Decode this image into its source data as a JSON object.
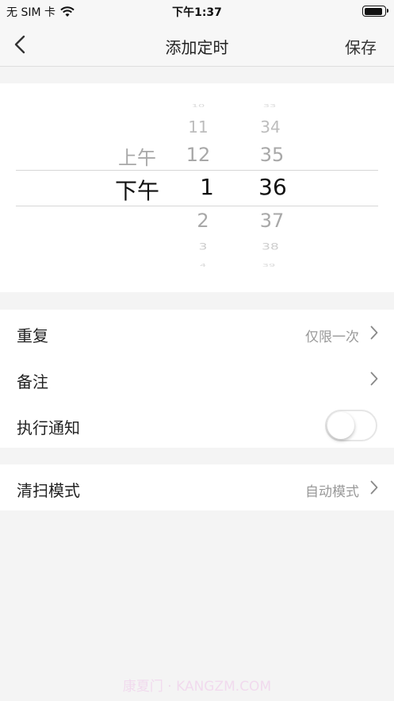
{
  "status_bar": {
    "carrier": "无 SIM 卡",
    "time": "下午1:37",
    "battery_level": 0.85
  },
  "nav": {
    "back_icon": "chevron-left-icon",
    "title": "添加定时",
    "save_label": "保存"
  },
  "picker": {
    "period": {
      "items": [
        "上午",
        "下午"
      ],
      "selected": "下午"
    },
    "hour": {
      "items": [
        "10",
        "11",
        "12",
        "1",
        "2",
        "3",
        "4"
      ],
      "selected": "1"
    },
    "minute": {
      "items": [
        "33",
        "34",
        "35",
        "36",
        "37",
        "38",
        "39"
      ],
      "selected": "36"
    }
  },
  "settings": {
    "repeat": {
      "label": "重复",
      "value": "仅限一次"
    },
    "note": {
      "label": "备注"
    },
    "notify": {
      "label": "执行通知",
      "enabled": false
    }
  },
  "clean": {
    "label": "清扫模式",
    "value": "自动模式"
  },
  "watermark": "康夏门 · KANGZM.COM",
  "colors": {
    "background": "#f4f4f4",
    "separator": "#d6d6d6",
    "secondary_text": "#999999"
  }
}
